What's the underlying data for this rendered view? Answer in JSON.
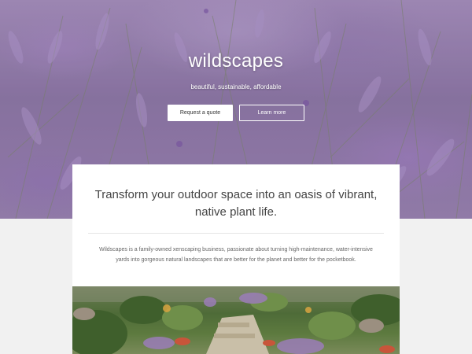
{
  "hero": {
    "title": "wildscapes",
    "tagline": "beautiful, sustainable, affordable",
    "buttons": {
      "quote": "Request a quote",
      "learn": "Learn more"
    }
  },
  "intro": {
    "headline": "Transform your outdoor space into an oasis of vibrant, native plant life.",
    "body": "Wildscapes is a family-owned xenscaping business, passionate about turning high-maintenance, water-intensive yards into gorgeous natural landscapes that are better for the planet and better for the pocketbook."
  },
  "colors": {
    "hero_tint": "#9a84b2",
    "page_bg": "#f1f1f1",
    "card_bg": "#ffffff",
    "text": "#444444"
  }
}
